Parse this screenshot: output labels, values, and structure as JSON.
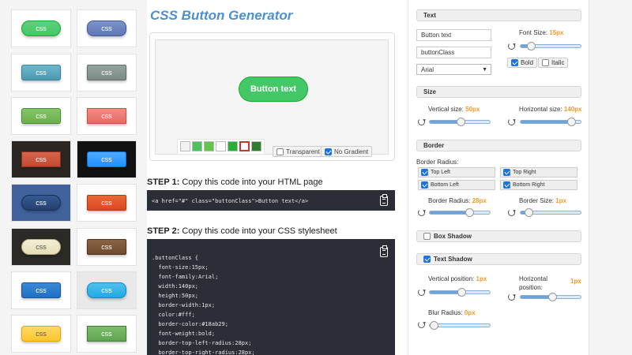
{
  "gallery": [
    {
      "label": "css",
      "bg": "#44c767",
      "grad": "#5cd37b",
      "border": "#18ab29",
      "radius": "12px",
      "frame": "#ffffff",
      "text": "#ffffff"
    },
    {
      "label": "css",
      "bg": "#5d77b5",
      "grad": "#7b93c9",
      "border": "#3e5a9a",
      "radius": "8px",
      "frame": "#ffffff",
      "text": "#ffffff"
    },
    {
      "label": "css",
      "bg": "#4a9ab0",
      "grad": "#6fb7cb",
      "border": "#3c8096",
      "radius": "3px",
      "frame": "#ffffff",
      "text": "#ffffff"
    },
    {
      "label": "css",
      "bg": "#7b8a86",
      "grad": "#95a39f",
      "border": "#5f6e6a",
      "radius": "2px",
      "frame": "#ffffff",
      "text": "#ffffff"
    },
    {
      "label": "css",
      "bg": "#6ab04c",
      "grad": "#86c56a",
      "border": "#4e8c33",
      "radius": "3px",
      "frame": "#ffffff",
      "text": "#ffffff"
    },
    {
      "label": "css",
      "bg": "#e66b62",
      "grad": "#f08d85",
      "border": "#c9514a",
      "radius": "0px",
      "frame": "#ffffff",
      "text": "#ffffff"
    },
    {
      "label": "css",
      "bg": "#c44a32",
      "grad": "#d6634b",
      "border": "#8d2f1d",
      "radius": "0px",
      "frame": "#2b2622",
      "text": "#ffffff"
    },
    {
      "label": "css",
      "bg": "#1e90ff",
      "grad": "#4faaff",
      "border": "#0b6ed6",
      "radius": "3px",
      "frame": "#111111",
      "text": "#ffffff"
    },
    {
      "label": "css",
      "bg": "#25406e",
      "grad": "#355a94",
      "border": "#1a2f54",
      "radius": "12px",
      "frame": "#42629e",
      "text": "#ffffff"
    },
    {
      "label": "css",
      "bg": "#d9491e",
      "grad": "#e96639",
      "border": "#b03910",
      "radius": "2px",
      "frame": "#ffffff",
      "text": "#ffffff"
    },
    {
      "label": "css",
      "bg": "#e7dfbb",
      "grad": "#f3edd2",
      "border": "#b5aa7c",
      "radius": "12px",
      "frame": "#2b2a26",
      "text": "#555555"
    },
    {
      "label": "css",
      "bg": "#6e4a2e",
      "grad": "#8b6445",
      "border": "#4e3320",
      "radius": "2px",
      "frame": "#ffffff",
      "text": "#ffffff"
    },
    {
      "label": "css",
      "bg": "#1f6fc2",
      "grad": "#3b8ad9",
      "border": "#15559a",
      "radius": "3px",
      "frame": "#ffffff",
      "text": "#ffffff"
    },
    {
      "label": "css",
      "bg": "#22a9e4",
      "grad": "#4fc0ef",
      "border": "#1488bc",
      "radius": "8px",
      "frame": "#e9e9e9",
      "text": "#ffffff"
    },
    {
      "label": "css",
      "bg": "#ffc62e",
      "grad": "#ffd966",
      "border": "#e0a800",
      "radius": "4px",
      "frame": "#ffffff",
      "text": "#555555"
    },
    {
      "label": "css",
      "bg": "#5fa550",
      "grad": "#7bbd6c",
      "border": "#3f7e33",
      "radius": "0px",
      "frame": "#ffffff",
      "text": "#ffffff"
    }
  ],
  "header": {
    "title": "CSS Button Generator"
  },
  "preview": {
    "button_text": "Button text",
    "button_color": "#44c767",
    "swatches": [
      "#f2f2f2",
      "#4cc35d",
      "#62c64a",
      "#ffffff",
      "#27ae3a",
      "#ffffff",
      "#2e7d32"
    ],
    "selected_swatch": 5,
    "transparent_label": "Transparent",
    "transparent_checked": false,
    "no_gradient_label": "No Gradient",
    "no_gradient_checked": true
  },
  "steps": {
    "step1_bold": "STEP 1:",
    "step1_text": " Copy this code into your HTML page",
    "html_code": "<a href=\"#\" class=\"buttonClass\">Button text</a>",
    "step2_bold": "STEP 2:",
    "step2_text": " Copy this code into your CSS stylesheet",
    "css_lines": [
      ".buttonClass {",
      "  font-size:15px;",
      "  font-family:Arial;",
      "  width:140px;",
      "  height:50px;",
      "  border-width:1px;",
      "  color:#fff;",
      "  border-color:#18ab29;",
      "  font-weight:bold;",
      "  border-top-left-radius:28px;",
      "  border-top-right-radius:28px;"
    ]
  },
  "panel": {
    "text_section": "Text",
    "button_text_value": "Button text",
    "class_value": "buttonClass",
    "font_family": "Arial",
    "font_size_label": "Font Size:",
    "font_size_value": "15px",
    "font_size_pos": 0.12,
    "bold_label": "Bold",
    "bold_checked": true,
    "italic_label": "Italic",
    "italic_checked": false,
    "size_section": "Size",
    "vertical_label": "Vertical size:",
    "vertical_value": "50px",
    "vertical_pos": 0.5,
    "horizontal_label": "Horizontal size:",
    "horizontal_value": "140px",
    "horizontal_pos": 0.88,
    "border_section": "Border",
    "border_radius_heading": "Border Radius:",
    "corners": [
      {
        "label": "Top Left",
        "checked": true
      },
      {
        "label": "Top Right",
        "checked": true
      },
      {
        "label": "Bottom Left",
        "checked": true
      },
      {
        "label": "Bottom Right",
        "checked": true
      }
    ],
    "br_label": "Border Radius:",
    "br_value": "28px",
    "br_pos": 0.67,
    "bs_label": "Border Size:",
    "bs_value": "1px",
    "bs_pos": 0.08,
    "box_shadow_section": "Box Shadow",
    "box_shadow_checked": false,
    "text_shadow_section": "Text Shadow",
    "text_shadow_checked": true,
    "tv_label": "Vertical position:",
    "tv_value": "1px",
    "tv_pos": 0.52,
    "th_label": "Horizontal position:",
    "th_value": "1px",
    "th_pos": 0.52,
    "blur_label": "Blur Radius:",
    "blur_value": "0px",
    "blur_pos": 0.0
  }
}
